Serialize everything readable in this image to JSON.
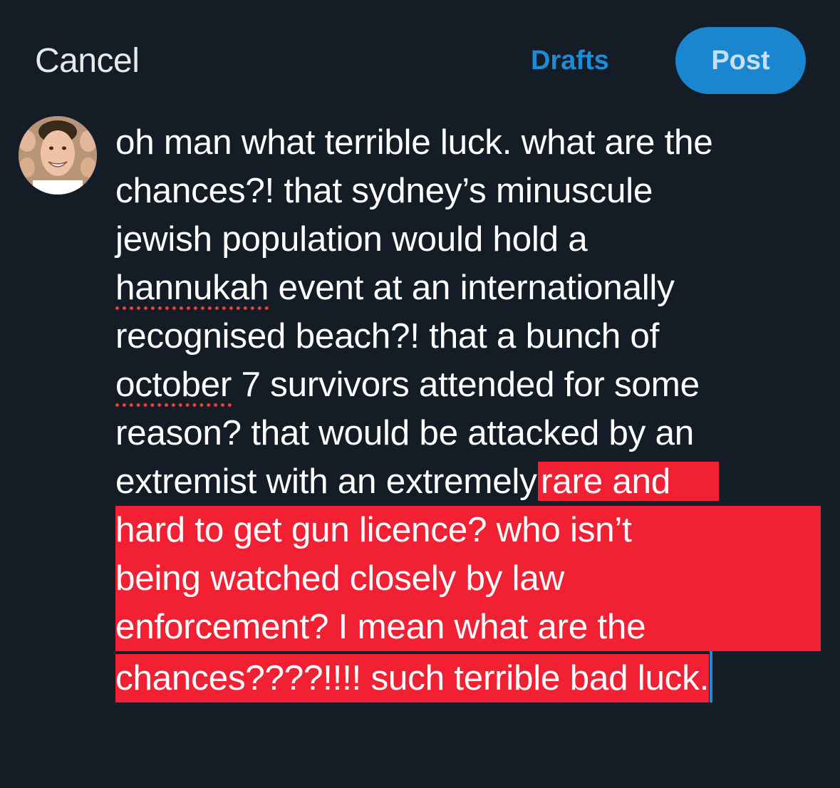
{
  "header": {
    "cancel_label": "Cancel",
    "drafts_label": "Drafts",
    "post_label": "Post"
  },
  "composer": {
    "avatar": "profile-photo",
    "lines": [
      "oh man what terrible luck. what are the",
      "chances?! that sydney’s minuscule",
      "jewish population would hold a",
      "hannukah",
      " event at an internationally",
      "recognised beach?! that a bunch of",
      "october",
      " 7 survivors attended for some",
      "reason? that would be attacked by an",
      "extremist with an extremely ",
      "rare and",
      "hard to get gun licence? who isn’t",
      "being watched closely by law",
      "enforcement? I mean what are the",
      "chances????!!!! such terrible bad luck."
    ]
  },
  "colors": {
    "background": "#141d26",
    "accent": "#1d8cd8",
    "highlight": "#f22033",
    "spellcheck": "#e0433d"
  }
}
